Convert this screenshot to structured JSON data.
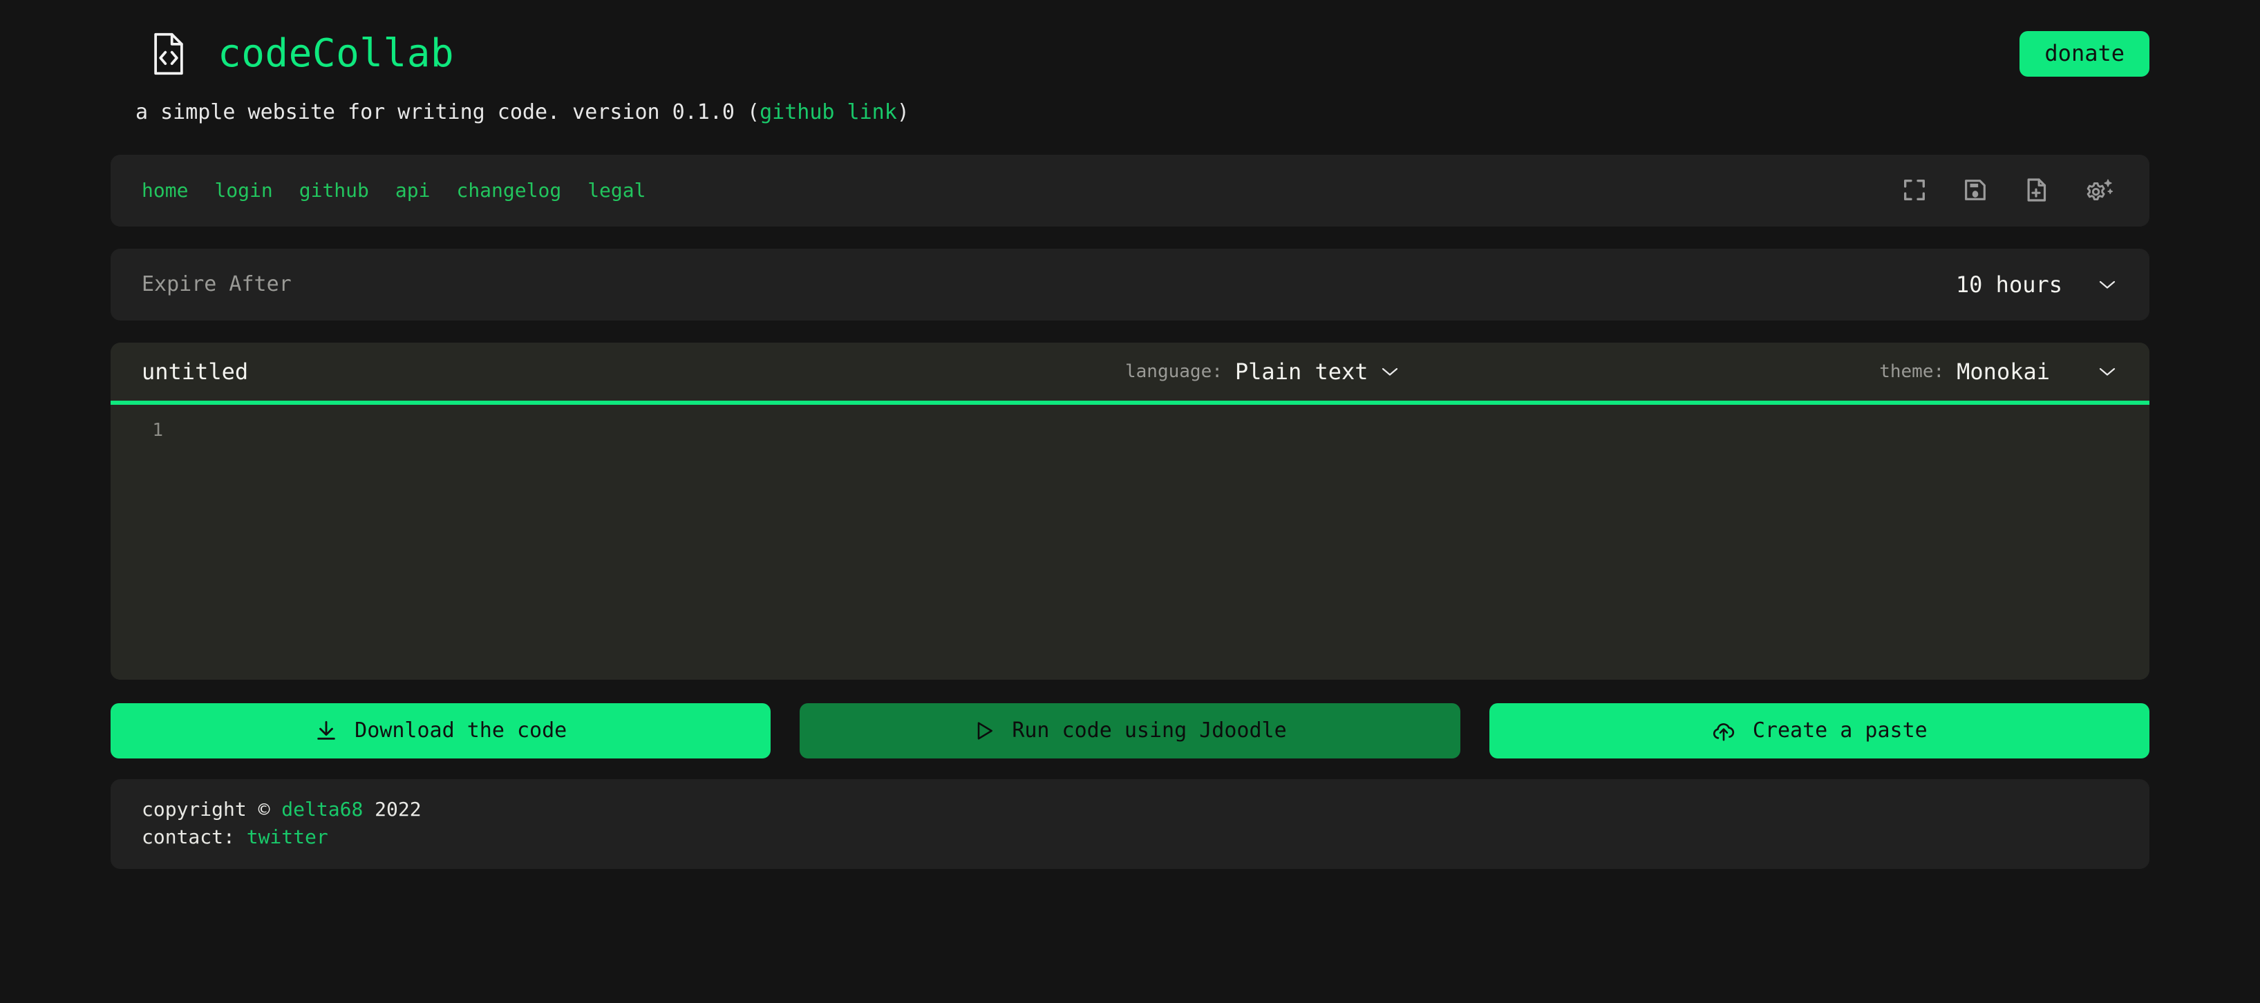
{
  "app": {
    "brand_name": "codeCollab",
    "brand_icon": "code-file-icon",
    "donate_label": "donate",
    "tagline_pre": "a simple website for writing code. version 0.1.0 (",
    "tagline_link": "github link",
    "tagline_post": ")",
    "accent_green": "#0fe87e",
    "link_green": "#19c96a",
    "page_background": "#141414",
    "panel_background": "#212121",
    "editor_background": "#272823"
  },
  "nav": {
    "items": [
      {
        "label": "home",
        "name": "nav-link-home"
      },
      {
        "label": "login",
        "name": "nav-link-login"
      },
      {
        "label": "github",
        "name": "nav-link-github"
      },
      {
        "label": "api",
        "name": "nav-link-api"
      },
      {
        "label": "changelog",
        "name": "nav-link-changelog"
      },
      {
        "label": "legal",
        "name": "nav-link-legal"
      }
    ],
    "icons": [
      {
        "name": "fullscreen-icon"
      },
      {
        "name": "save-icon"
      },
      {
        "name": "new-file-icon"
      },
      {
        "name": "settings-sparkle-icon"
      }
    ]
  },
  "expire": {
    "label": "Expire After",
    "value": "10 hours",
    "chevron": "chevron-down-icon"
  },
  "editor": {
    "file_name": "untitled",
    "file_name_placeholder": "untitled",
    "language_label": "language:",
    "language_value": "Plain text",
    "theme_label": "theme:",
    "theme_value": "Monokai",
    "line_numbers": [
      "1"
    ],
    "code": "",
    "code_placeholder": ""
  },
  "actions": [
    {
      "label": "Download the code",
      "icon": "download-icon",
      "name": "download-code-button",
      "style": "primary"
    },
    {
      "label": "Run code using Jdoodle",
      "icon": "play-icon",
      "name": "run-code-button",
      "style": "muted"
    },
    {
      "label": "Create a paste",
      "icon": "cloud-upload-icon",
      "name": "create-paste-button",
      "style": "primary"
    }
  ],
  "footer": {
    "copyright_pre": "copyright © ",
    "copyright_author": "delta68",
    "copyright_post": " 2022",
    "contact_pre": "contact: ",
    "contact_link": "twitter"
  }
}
